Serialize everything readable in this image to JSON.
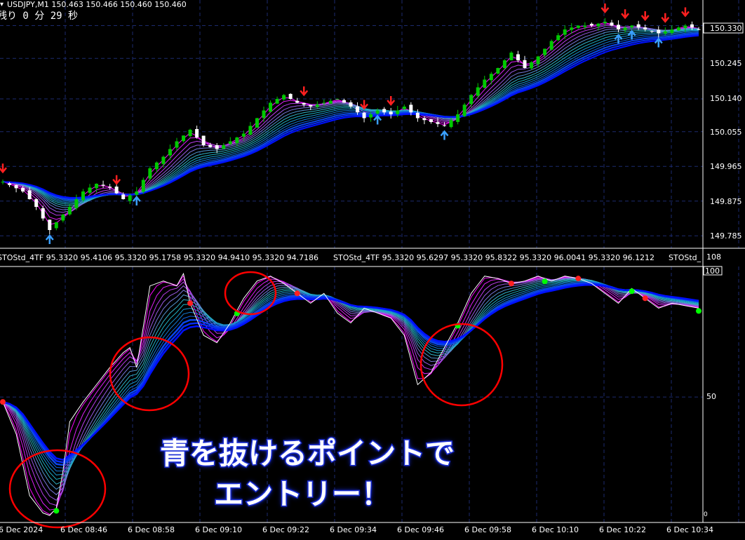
{
  "header": {
    "symbol_line": "USDJPY,M1  150.463 150.466 150.460 150.460",
    "remaining_time": "残り 0 分 29 秒",
    "left_glyph": "▾"
  },
  "price_axis": {
    "labels": [
      "150.330",
      "150.245",
      "150.140",
      "150.055",
      "149.965",
      "149.875",
      "149.785"
    ]
  },
  "indicator": {
    "header_left": "STOStd_4TF 95.3320 95.4106 95.3320 95.1758 95.3320 94.9410 95.3320 94.7186",
    "header_right": "STOStd_4TF 95.3320 95.6297 95.3320 95.8322 95.3320 96.0041 95.3320 96.1212",
    "header_tail": "STOStd_",
    "axis_max": "108",
    "axis_100": "100",
    "axis_50": "50",
    "axis_0": "0"
  },
  "time_axis": {
    "labels": [
      "6 Dec 2024",
      "6 Dec 08:46",
      "6 Dec 08:58",
      "6 Dec 09:10",
      "6 Dec 09:22",
      "6 Dec 09:34",
      "6 Dec 09:46",
      "6 Dec 09:58",
      "6 Dec 10:10",
      "6 Dec 10:22",
      "6 Dec 10:34"
    ]
  },
  "annotation": {
    "line1": "青を抜けるポイントで",
    "line2": "エントリー！"
  },
  "colors": {
    "background": "#000000",
    "grid": "#1c2a6e",
    "bull_candle": "#00c800",
    "bear_candle": "#ffffff",
    "ribbon_fast": "#ff00ff",
    "ribbon_mid": "#20c0c0",
    "ribbon_slow": "#0010ff",
    "sell_arrow": "#ff2020",
    "buy_arrow": "#3aa0ff",
    "circle": "#ff0000",
    "callout_fill": "#ffffff",
    "callout_stroke": "#1c2fd6"
  },
  "chart_data": [
    {
      "type": "candlestick",
      "title": "USDJPY,M1",
      "y_ticks": [
        150.33,
        150.245,
        150.14,
        150.055,
        149.965,
        149.875,
        149.785
      ],
      "ylim": [
        149.76,
        150.36
      ],
      "x_ticks": [
        "6 Dec 2024",
        "6 Dec 08:46",
        "6 Dec 08:58",
        "6 Dec 09:10",
        "6 Dec 09:22",
        "6 Dec 09:34",
        "6 Dec 09:46",
        "6 Dec 09:58",
        "6 Dec 10:10",
        "6 Dec 10:22",
        "6 Dec 10:34"
      ],
      "close_path": [
        [
          0,
          149.925
        ],
        [
          3,
          149.9
        ],
        [
          5,
          149.86
        ],
        [
          7,
          149.8
        ],
        [
          8,
          149.82
        ],
        [
          10,
          149.86
        ],
        [
          12,
          149.9
        ],
        [
          14,
          149.92
        ],
        [
          16,
          149.91
        ],
        [
          18,
          149.88
        ],
        [
          20,
          149.9
        ],
        [
          22,
          149.96
        ],
        [
          24,
          149.99
        ],
        [
          26,
          150.03
        ],
        [
          28,
          150.06
        ],
        [
          30,
          150.02
        ],
        [
          32,
          150.01
        ],
        [
          34,
          150.03
        ],
        [
          36,
          150.05
        ],
        [
          38,
          150.09
        ],
        [
          40,
          150.13
        ],
        [
          42,
          150.15
        ],
        [
          44,
          150.13
        ],
        [
          46,
          150.12
        ],
        [
          48,
          150.13
        ],
        [
          50,
          150.14
        ],
        [
          52,
          150.12
        ],
        [
          54,
          150.09
        ],
        [
          56,
          150.11
        ],
        [
          58,
          150.1
        ],
        [
          60,
          150.12
        ],
        [
          62,
          150.09
        ],
        [
          64,
          150.08
        ],
        [
          66,
          150.07
        ],
        [
          68,
          150.1
        ],
        [
          70,
          150.15
        ],
        [
          72,
          150.19
        ],
        [
          74,
          150.22
        ],
        [
          76,
          150.26
        ],
        [
          78,
          150.22
        ],
        [
          80,
          150.25
        ],
        [
          82,
          150.29
        ],
        [
          84,
          150.32
        ],
        [
          86,
          150.33
        ],
        [
          88,
          150.33
        ],
        [
          90,
          150.34
        ],
        [
          92,
          150.32
        ],
        [
          94,
          150.33
        ],
        [
          96,
          150.32
        ],
        [
          98,
          150.31
        ],
        [
          100,
          150.32
        ],
        [
          102,
          150.33
        ],
        [
          104,
          150.32
        ]
      ]
    },
    {
      "type": "line",
      "title": "STOStd_4TF",
      "ylim": [
        0,
        108
      ],
      "y_ticks": [
        0,
        50,
        100
      ],
      "series": [
        {
          "name": "STOStd_4TF",
          "x": [
            0,
            2,
            4,
            6,
            7,
            8,
            9,
            10,
            12,
            14,
            16,
            18,
            19,
            20,
            22,
            24,
            26,
            27,
            28,
            30,
            32,
            34,
            36,
            38,
            40,
            42,
            44,
            46,
            48,
            50,
            52,
            54,
            56,
            58,
            60,
            62,
            64,
            66,
            68,
            70,
            72,
            74,
            76,
            78,
            80,
            82,
            84,
            86,
            88,
            90,
            92,
            94,
            96,
            98,
            100,
            102,
            104
          ],
          "values": [
            48,
            35,
            10,
            3,
            2,
            5,
            20,
            40,
            48,
            55,
            62,
            68,
            70,
            62,
            95,
            97,
            95,
            100,
            88,
            75,
            72,
            80,
            90,
            97,
            99,
            96,
            92,
            88,
            92,
            84,
            80,
            86,
            84,
            82,
            75,
            55,
            60,
            70,
            80,
            92,
            99,
            98,
            96,
            97,
            99,
            97,
            99,
            98,
            96,
            92,
            88,
            94,
            90,
            86,
            88,
            87,
            86
          ]
        }
      ]
    }
  ]
}
